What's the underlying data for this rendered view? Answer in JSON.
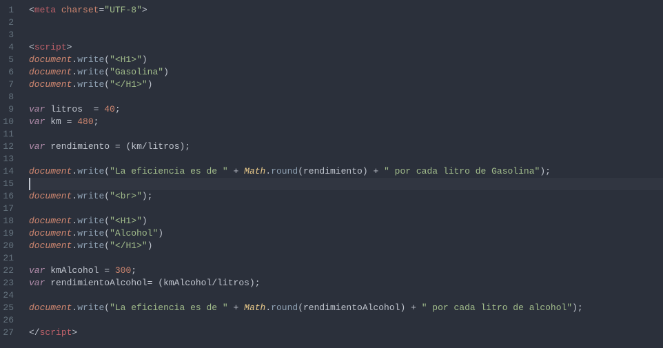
{
  "editor": {
    "activeLine": 15,
    "lines": [
      {
        "num": 1,
        "tokens": [
          [
            "t-punc",
            "<"
          ],
          [
            "t-tag",
            "meta"
          ],
          [
            "t-punc",
            " "
          ],
          [
            "t-attr",
            "charset"
          ],
          [
            "t-punc",
            "="
          ],
          [
            "t-str",
            "\"UTF-8\""
          ],
          [
            "t-punc",
            ">"
          ]
        ]
      },
      {
        "num": 2,
        "tokens": []
      },
      {
        "num": 3,
        "tokens": []
      },
      {
        "num": 4,
        "tokens": [
          [
            "t-punc",
            "<"
          ],
          [
            "t-tag",
            "script"
          ],
          [
            "t-punc",
            ">"
          ]
        ]
      },
      {
        "num": 5,
        "tokens": [
          [
            "t-obj",
            "document"
          ],
          [
            "t-punc",
            "."
          ],
          [
            "t-fn",
            "write"
          ],
          [
            "t-punc",
            "("
          ],
          [
            "t-str",
            "\"<H1>\""
          ],
          [
            "t-punc",
            ")"
          ]
        ]
      },
      {
        "num": 6,
        "tokens": [
          [
            "t-obj",
            "document"
          ],
          [
            "t-punc",
            "."
          ],
          [
            "t-fn",
            "write"
          ],
          [
            "t-punc",
            "("
          ],
          [
            "t-str",
            "\"Gasolina\""
          ],
          [
            "t-punc",
            ")"
          ]
        ]
      },
      {
        "num": 7,
        "tokens": [
          [
            "t-obj",
            "document"
          ],
          [
            "t-punc",
            "."
          ],
          [
            "t-fn",
            "write"
          ],
          [
            "t-punc",
            "("
          ],
          [
            "t-str",
            "\"</H1>\""
          ],
          [
            "t-punc",
            ")"
          ]
        ]
      },
      {
        "num": 8,
        "tokens": []
      },
      {
        "num": 9,
        "tokens": [
          [
            "t-kw-i",
            "var"
          ],
          [
            "t-var",
            " litros  "
          ],
          [
            "t-punc",
            "="
          ],
          [
            "t-var",
            " "
          ],
          [
            "t-num",
            "40"
          ],
          [
            "t-punc",
            ";"
          ]
        ]
      },
      {
        "num": 10,
        "tokens": [
          [
            "t-kw-i",
            "var"
          ],
          [
            "t-var",
            " km "
          ],
          [
            "t-punc",
            "="
          ],
          [
            "t-var",
            " "
          ],
          [
            "t-num",
            "480"
          ],
          [
            "t-punc",
            ";"
          ]
        ]
      },
      {
        "num": 11,
        "tokens": []
      },
      {
        "num": 12,
        "tokens": [
          [
            "t-kw-i",
            "var"
          ],
          [
            "t-var",
            " rendimiento "
          ],
          [
            "t-punc",
            "="
          ],
          [
            "t-var",
            " "
          ],
          [
            "t-punc",
            "("
          ],
          [
            "t-var",
            "km"
          ],
          [
            "t-punc",
            "/"
          ],
          [
            "t-var",
            "litros"
          ],
          [
            "t-punc",
            ");"
          ]
        ]
      },
      {
        "num": 13,
        "tokens": []
      },
      {
        "num": 14,
        "tokens": [
          [
            "t-obj",
            "document"
          ],
          [
            "t-punc",
            "."
          ],
          [
            "t-fn",
            "write"
          ],
          [
            "t-punc",
            "("
          ],
          [
            "t-str",
            "\"La eficiencia es de \""
          ],
          [
            "t-var",
            " "
          ],
          [
            "t-punc",
            "+"
          ],
          [
            "t-var",
            " "
          ],
          [
            "t-class",
            "Math"
          ],
          [
            "t-punc",
            "."
          ],
          [
            "t-fn",
            "round"
          ],
          [
            "t-punc",
            "("
          ],
          [
            "t-var",
            "rendimiento"
          ],
          [
            "t-punc",
            ")"
          ],
          [
            "t-var",
            " "
          ],
          [
            "t-punc",
            "+"
          ],
          [
            "t-var",
            " "
          ],
          [
            "t-str",
            "\" por cada litro de Gasolina\""
          ],
          [
            "t-punc",
            ");"
          ]
        ]
      },
      {
        "num": 15,
        "tokens": []
      },
      {
        "num": 16,
        "tokens": [
          [
            "t-obj",
            "document"
          ],
          [
            "t-punc",
            "."
          ],
          [
            "t-fn",
            "write"
          ],
          [
            "t-punc",
            "("
          ],
          [
            "t-str",
            "\"<br>\""
          ],
          [
            "t-punc",
            ");"
          ]
        ]
      },
      {
        "num": 17,
        "tokens": []
      },
      {
        "num": 18,
        "tokens": [
          [
            "t-obj",
            "document"
          ],
          [
            "t-punc",
            "."
          ],
          [
            "t-fn",
            "write"
          ],
          [
            "t-punc",
            "("
          ],
          [
            "t-str",
            "\"<H1>\""
          ],
          [
            "t-punc",
            ")"
          ]
        ]
      },
      {
        "num": 19,
        "tokens": [
          [
            "t-obj",
            "document"
          ],
          [
            "t-punc",
            "."
          ],
          [
            "t-fn",
            "write"
          ],
          [
            "t-punc",
            "("
          ],
          [
            "t-str",
            "\"Alcohol\""
          ],
          [
            "t-punc",
            ")"
          ]
        ]
      },
      {
        "num": 20,
        "tokens": [
          [
            "t-obj",
            "document"
          ],
          [
            "t-punc",
            "."
          ],
          [
            "t-fn",
            "write"
          ],
          [
            "t-punc",
            "("
          ],
          [
            "t-str",
            "\"</H1>\""
          ],
          [
            "t-punc",
            ")"
          ]
        ]
      },
      {
        "num": 21,
        "tokens": []
      },
      {
        "num": 22,
        "tokens": [
          [
            "t-kw-i",
            "var"
          ],
          [
            "t-var",
            " kmAlcohol "
          ],
          [
            "t-punc",
            "="
          ],
          [
            "t-var",
            " "
          ],
          [
            "t-num",
            "300"
          ],
          [
            "t-punc",
            ";"
          ]
        ]
      },
      {
        "num": 23,
        "tokens": [
          [
            "t-kw-i",
            "var"
          ],
          [
            "t-var",
            " rendimientoAlcohol"
          ],
          [
            "t-punc",
            "="
          ],
          [
            "t-var",
            " "
          ],
          [
            "t-punc",
            "("
          ],
          [
            "t-var",
            "kmAlcohol"
          ],
          [
            "t-punc",
            "/"
          ],
          [
            "t-var",
            "litros"
          ],
          [
            "t-punc",
            ");"
          ]
        ]
      },
      {
        "num": 24,
        "tokens": []
      },
      {
        "num": 25,
        "tokens": [
          [
            "t-obj",
            "document"
          ],
          [
            "t-punc",
            "."
          ],
          [
            "t-fn",
            "write"
          ],
          [
            "t-punc",
            "("
          ],
          [
            "t-str",
            "\"La eficiencia es de \""
          ],
          [
            "t-var",
            " "
          ],
          [
            "t-punc",
            "+"
          ],
          [
            "t-var",
            " "
          ],
          [
            "t-class",
            "Math"
          ],
          [
            "t-punc",
            "."
          ],
          [
            "t-fn",
            "round"
          ],
          [
            "t-punc",
            "("
          ],
          [
            "t-var",
            "rendimientoAlcohol"
          ],
          [
            "t-punc",
            ")"
          ],
          [
            "t-var",
            " "
          ],
          [
            "t-punc",
            "+"
          ],
          [
            "t-var",
            " "
          ],
          [
            "t-str",
            "\" por cada litro de alcohol\""
          ],
          [
            "t-punc",
            ");"
          ]
        ]
      },
      {
        "num": 26,
        "tokens": []
      },
      {
        "num": 27,
        "tokens": [
          [
            "t-punc",
            "</"
          ],
          [
            "t-tag",
            "script"
          ],
          [
            "t-punc",
            ">"
          ]
        ]
      }
    ]
  }
}
